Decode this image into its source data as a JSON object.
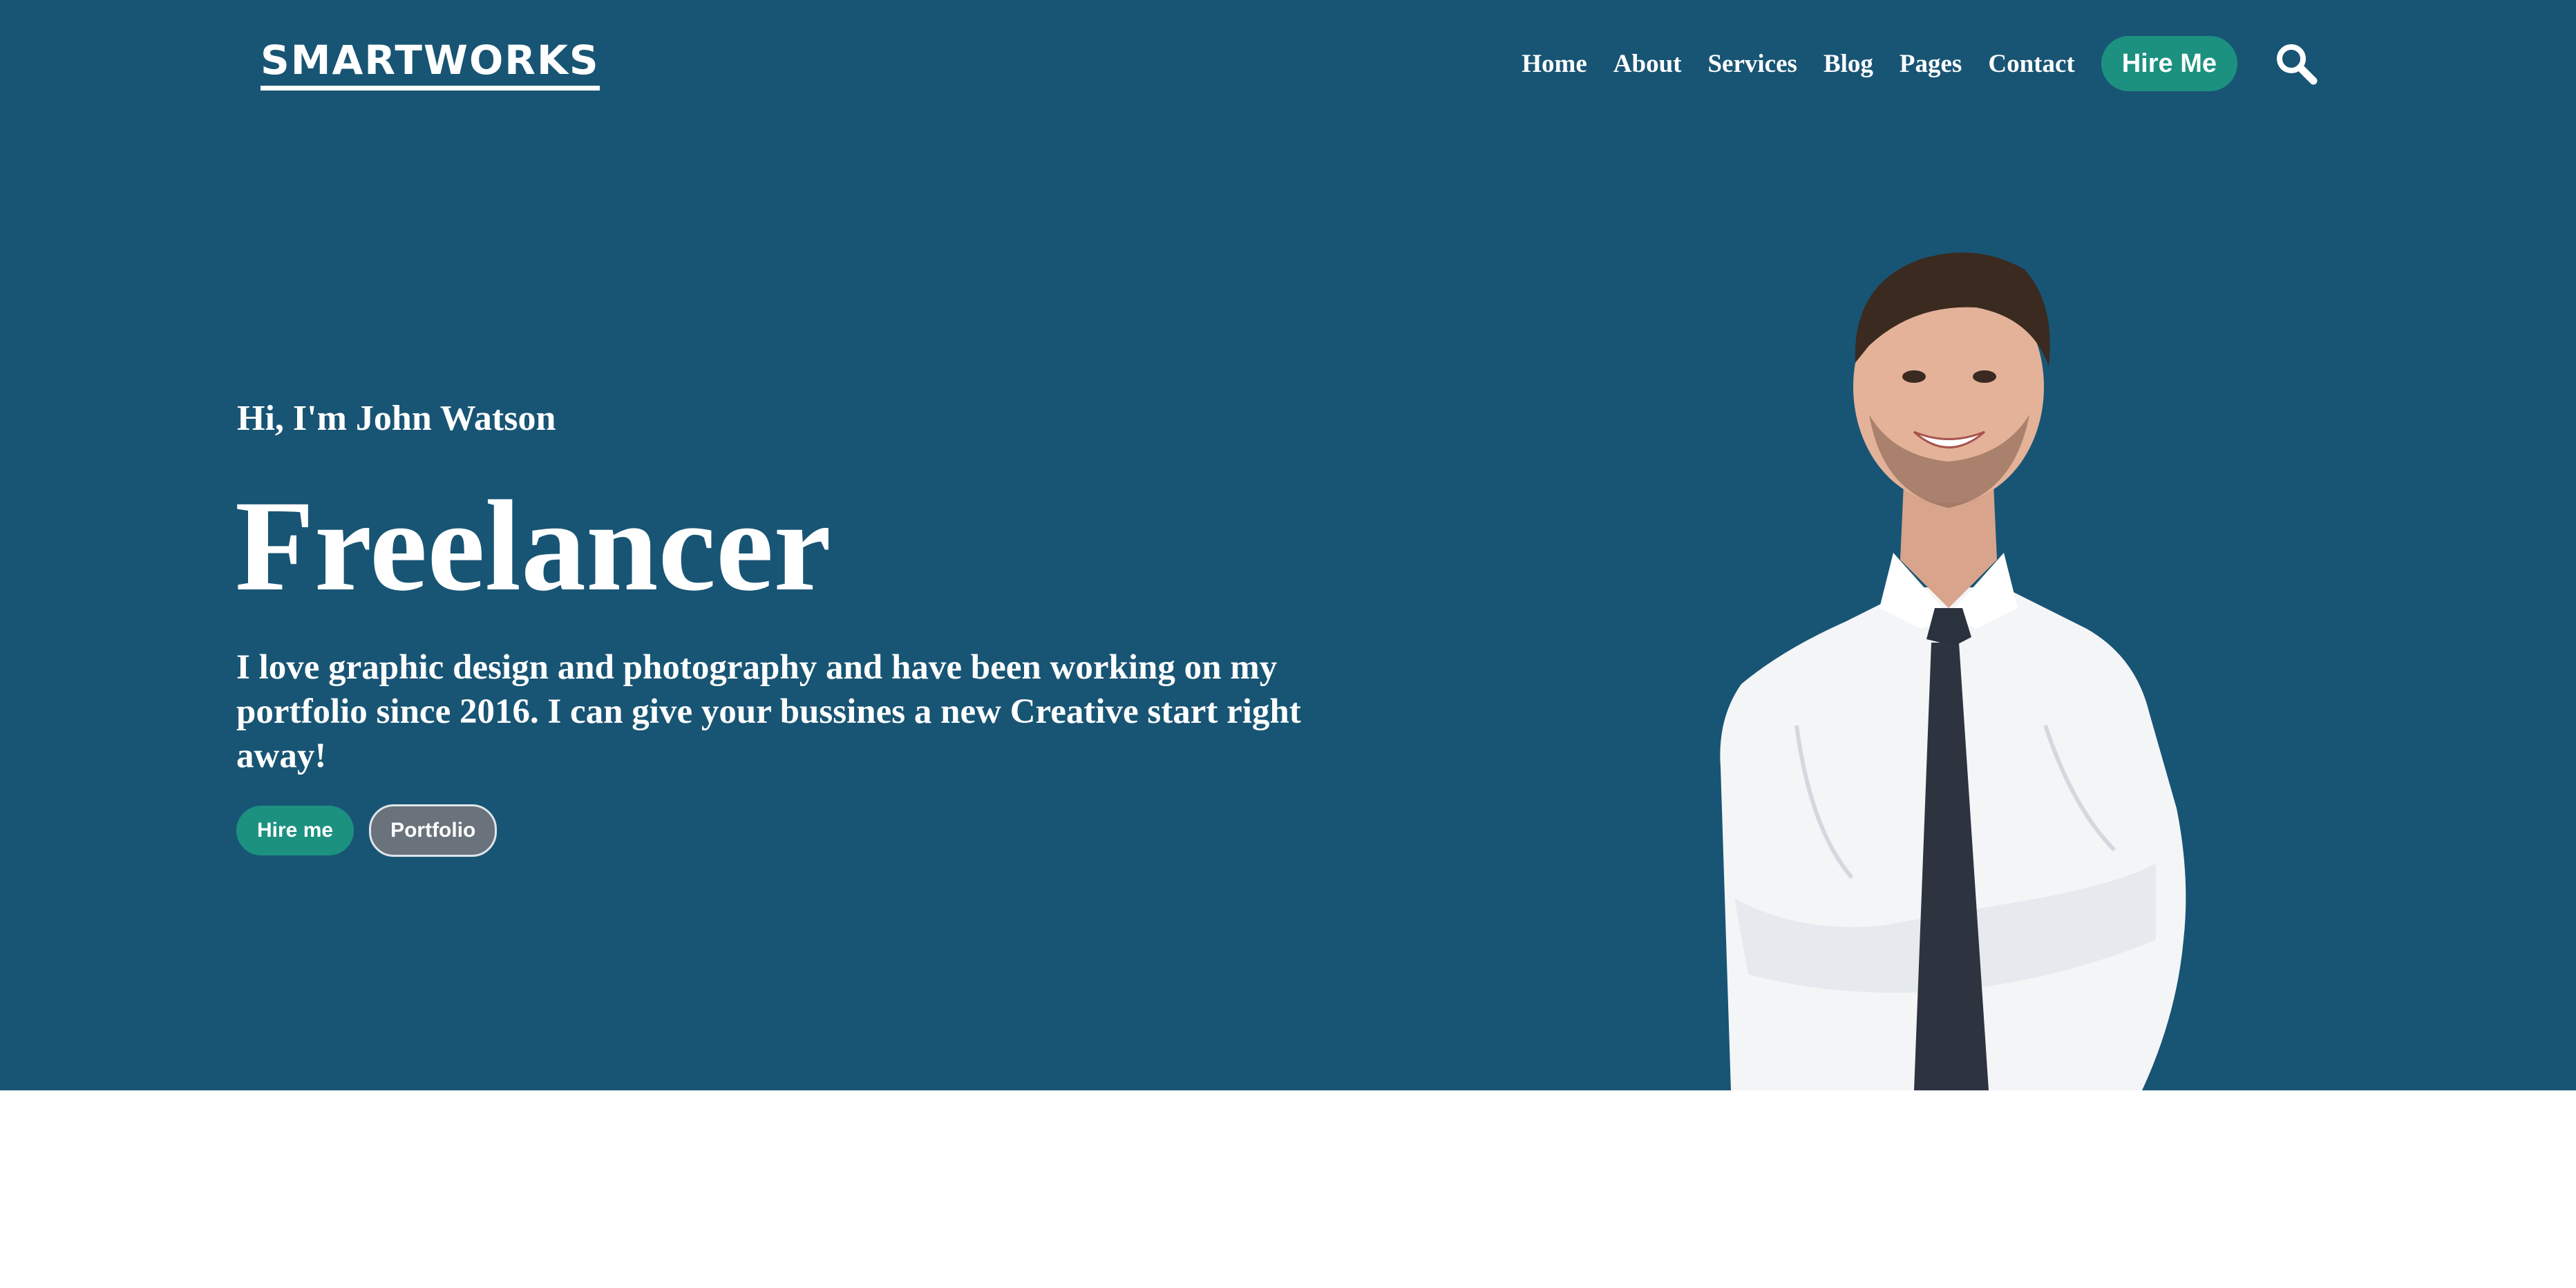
{
  "header": {
    "logo": "SMARTWORKS",
    "nav": [
      "Home",
      "About",
      "Services",
      "Blog",
      "Pages",
      "Contact"
    ],
    "hire_button": "Hire Me",
    "search_icon": "search-icon"
  },
  "hero": {
    "greeting": "Hi, I'm John Watson",
    "headline": "Freelancer",
    "description": "I love graphic design and photography and have been working on my portfolio since 2016. I can give your bussines a new Creative start right away!",
    "hire_button": "Hire me",
    "portfolio_button": "Portfolio",
    "image": "smiling-businessman-arms-crossed"
  },
  "colors": {
    "hero_background": "#185574",
    "accent": "#1c9180",
    "secondary_button": "#6a737c",
    "page_background": "#ffffff"
  }
}
